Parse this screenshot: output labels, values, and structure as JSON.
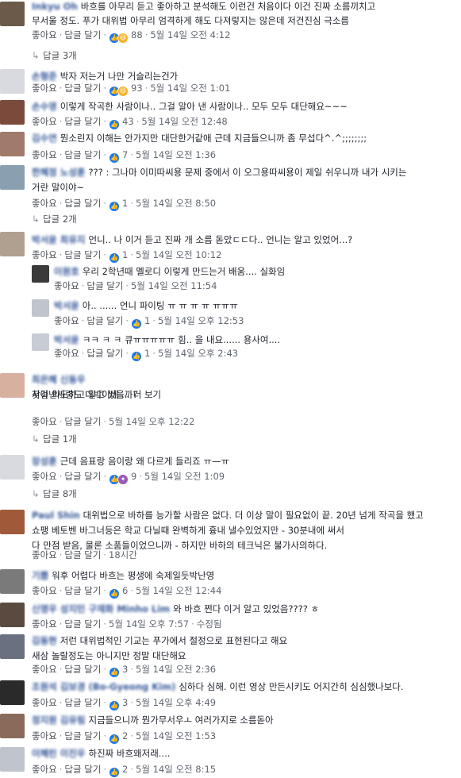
{
  "ui": {
    "like": "좋아요",
    "reply": "답글 달기",
    "edited": "수정됨"
  },
  "comments": [
    {
      "name": "Inkyu Oh",
      "lines": [
        "바흐를 아무리 듣고 좋아하고 분석해도 이런건 처음이다 이건 진짜 소름끼치고",
        "무서울 정도. 푸가 대위법 아무리 엄격하게 해도 다져렇지는 않은데 저건진심 극소름"
      ],
      "reactions": "88",
      "time": "5월 14일 오전 4:12",
      "replies_label": "답글 3개"
    },
    {
      "name": "손형준",
      "lines": [
        "박자 저는거 나만 거슬리는건가"
      ],
      "reactions": "93",
      "time": "5월 14일 오전 1:01"
    },
    {
      "name": "손수영",
      "lines": [
        "이렇게 작곡한 사람이나.. 그걸 알아 낸 사람이나.. 모두 모두 대단해요~~~"
      ],
      "reactions": "43",
      "time": "5월 14일 오전 12:48"
    },
    {
      "name": "김수연",
      "lines": [
        "뭔소린지 이해는 안가지만 대단한거같애 근데 지금들으니까 좀 무섭다^.^;;;;;;;;"
      ],
      "reactions": "7",
      "time": "5월 14일 오전 1:36"
    },
    {
      "name": "한혜정 노성훈",
      "lines": [
        "??? : 그나마 이미따씨용 문제 중에서 이 오그용따씨용이 제일 쉬우니까 내가 시키는",
        "거란 말이야~"
      ],
      "reactions": "1",
      "time": "5월 14일 오전 8:50",
      "replies_label": "답글 2개"
    },
    {
      "name": "박서윤 최유지",
      "lines": [
        "언니.. 나 이거 듣고 진짜 개 소름 돋았ㄷㄷ다.. 언니는 알고 있었어...?"
      ],
      "reactions": "1",
      "time": "5월 14일 오전 10:12"
    },
    {
      "name": "이원호",
      "lines": [
        "우리 2학년때 멜로디 이렇게 만드는거 배움.... 실화임"
      ],
      "reactions": "",
      "time": "5월 14일 오전 11:54"
    },
    {
      "name": "박서윤",
      "lines": [
        "아.. ...... 언니 파이팅 ㅠ ㅠ ㅠ ㅠ ㅠㅠㅠ"
      ],
      "reactions": "1",
      "time": "5월 14일 오후 12:53"
    },
    {
      "name": "박서윤",
      "lines": [
        "ㅋㅋ ㅋ ㅋ 큐ㅠㅠㅠㅠㅠ 힘.. 을 내요...... 용사여...."
      ],
      "reactions": "1",
      "time": "5월 14일 오후 2:43"
    },
    {
      "name": "최은혜 신동우",
      "lines": [
        "저걸 의도하고 알고 썼을까?",
        "찾아낸사람도 대박이네 ... 더 보기"
      ],
      "reactions": "",
      "time": "5월 14일 오후 12:22",
      "replies_label": "답글 1개"
    },
    {
      "name": "장성훈",
      "lines": [
        "근데 음표랑 음이랑 왜 다르게 들리죠 ㅠ—ㅠ"
      ],
      "reactions": "9",
      "time": "5월 14일 오전 1:09",
      "replies_label": "답글 8개"
    },
    {
      "name": "Paul Shin",
      "lines": [
        "대위법으로 바하를 능가할 사람은 없다. 더 이상 말이 필요없이 끝. 20년 넘게 작곡을 했고",
        "쇼팽 베토벤 바그너등은 학교 다닐때 완벽하게 흉내 낼수있었지만 - 30분내에 써서",
        "다 만점 받음, 물론 소품들이었으니까 - 하지만 바하의 테크닉은 불가사의하다."
      ],
      "reactions": "",
      "time": "18시간"
    },
    {
      "name": "기쁨",
      "lines": [
        "워후 어렵다 바흐는 평생에 숙제일듯박난영"
      ],
      "reactions": "6",
      "time": "5월 14일 오전 12:44"
    },
    {
      "name": "신명우 성지민 구재화 Minho Lim",
      "lines": [
        "와 바흐 쩐다 이거 알고 있었음???? ㅎ"
      ],
      "reactions": "",
      "time": "5월 14일 오후 7:57",
      "edited": true
    },
    {
      "name": "김동현",
      "lines": [
        "저런 대위법적인 기교는 푸가에서 절정으로 표현된다고 해요",
        "새삼 놀랄정도는 아니지만 정말 대단해요"
      ],
      "reactions": "3",
      "time": "5월 14일 오전 2:36"
    },
    {
      "name": "조원석 김보경 (Bo-Gyeong Kim)",
      "lines": [
        "심하다 심해. 이런 영상 만든시키도 어지간히 심심했나보다."
      ],
      "reactions": "3",
      "time": "5월 14일 오후 4:49"
    },
    {
      "name": "정지원 김유림",
      "lines": [
        "지금들으니까 뭔가무서우ㅗ 여러가지로 소름돋아"
      ],
      "reactions": "2",
      "time": "5월 14일 오전 1:53"
    },
    {
      "name": "이혜린 이진우",
      "lines": [
        "하진짜 바흐왜저래...."
      ],
      "reactions": "2",
      "time": "5월 14일 오전 8:15"
    }
  ],
  "colors": {
    "link": "#365899",
    "meta": "#616770",
    "like": "#1877f2"
  }
}
